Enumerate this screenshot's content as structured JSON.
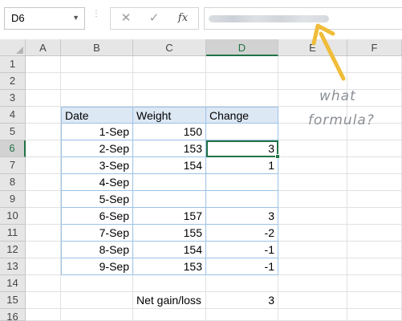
{
  "formula_bar": {
    "name_box": "D6",
    "buttons": {
      "cancel": "✕",
      "enter": "✓",
      "fx": "fx"
    },
    "formula_text": "=D6-C5 (blurred)"
  },
  "columns": [
    "A",
    "B",
    "C",
    "D",
    "E",
    "F"
  ],
  "selected_column": "D",
  "rows": [
    "1",
    "2",
    "3",
    "4",
    "5",
    "6",
    "7",
    "8",
    "9",
    "10",
    "11",
    "12",
    "13",
    "14",
    "15",
    "16"
  ],
  "selected_row": "6",
  "table": {
    "headers": {
      "date": "Date",
      "weight": "Weight",
      "change": "Change"
    },
    "rows": [
      {
        "date": "1-Sep",
        "weight": "150",
        "change": ""
      },
      {
        "date": "2-Sep",
        "weight": "153",
        "change": "3"
      },
      {
        "date": "3-Sep",
        "weight": "154",
        "change": "1"
      },
      {
        "date": "4-Sep",
        "weight": "",
        "change": ""
      },
      {
        "date": "5-Sep",
        "weight": "",
        "change": ""
      },
      {
        "date": "6-Sep",
        "weight": "157",
        "change": "3"
      },
      {
        "date": "7-Sep",
        "weight": "155",
        "change": "-2"
      },
      {
        "date": "8-Sep",
        "weight": "154",
        "change": "-1"
      },
      {
        "date": "9-Sep",
        "weight": "153",
        "change": "-1"
      }
    ]
  },
  "summary": {
    "label": "Net gain/loss",
    "value": "3"
  },
  "annotation": {
    "line1": "what",
    "line2": "formula?",
    "color": "#8a8f94"
  },
  "colors": {
    "accent": "#217346",
    "arrow": "#f0bd3a",
    "table_header": "#dde8f5",
    "table_border": "#9bc2e6"
  }
}
